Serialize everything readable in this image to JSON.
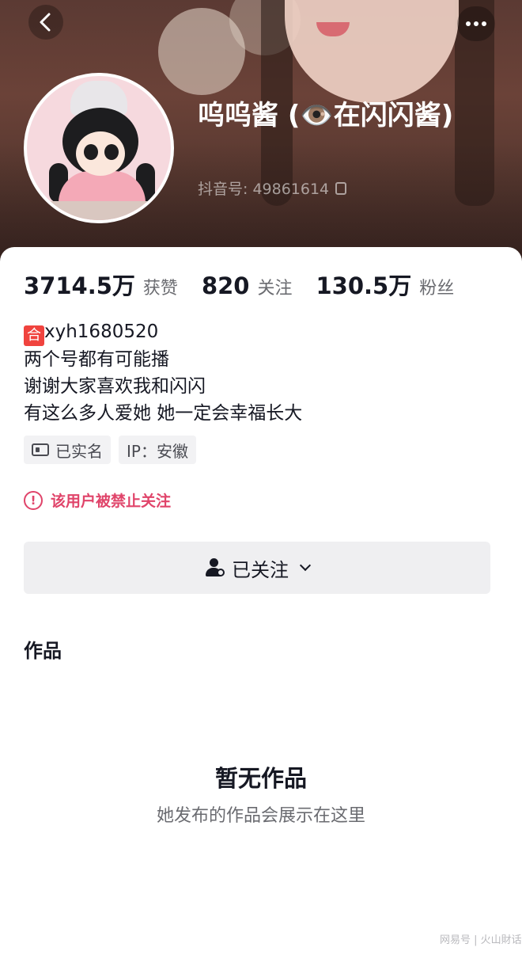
{
  "profile": {
    "nickname": "呜呜酱 (👁️在闪闪酱)",
    "douyin_id": "抖音号: 49861614"
  },
  "stats": [
    {
      "value": "3714.5万",
      "label": "获赞"
    },
    {
      "value": "820",
      "label": "关注"
    },
    {
      "value": "130.5万",
      "label": "粉丝"
    }
  ],
  "bio": {
    "collab_tag": "合",
    "collab_account": "xyh1680520",
    "lines": [
      "两个号都有可能播",
      "谢谢大家喜欢我和闪闪",
      "有这么多人爱她 她一定会幸福长大"
    ]
  },
  "chips": {
    "verified": "已实名",
    "ip": "IP：安徽"
  },
  "warning": "该用户被禁止关注",
  "follow_button": "已关注",
  "works": {
    "title": "作品",
    "empty_title": "暂无作品",
    "empty_subtitle": "她发布的作品会展示在这里"
  },
  "watermark": "网易号 | 火山財话",
  "colors": {
    "warning": "#e0446a",
    "collab_tag": "#f0433e"
  }
}
